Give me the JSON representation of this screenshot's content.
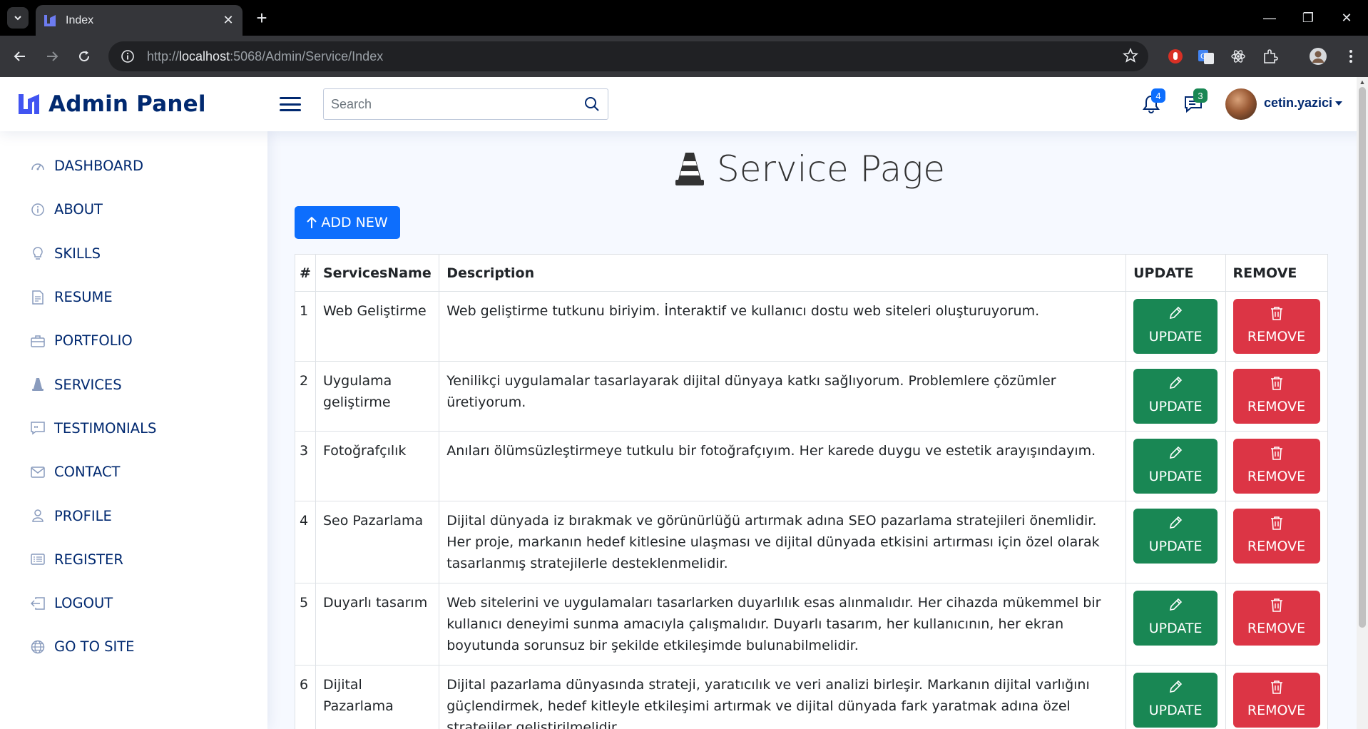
{
  "browser": {
    "tab_title": "Index",
    "url_scheme": "http://",
    "url_host": "localhost",
    "url_path": ":5068/Admin/Service/Index"
  },
  "header": {
    "brand": "Admin Panel",
    "search_placeholder": "Search",
    "notifications_count": "4",
    "messages_count": "3",
    "username": "cetin.yazici"
  },
  "sidebar": {
    "items": [
      {
        "label": "DASHBOARD",
        "icon": "speedometer-icon"
      },
      {
        "label": "ABOUT",
        "icon": "info-circle-icon"
      },
      {
        "label": "SKILLS",
        "icon": "lightbulb-icon"
      },
      {
        "label": "RESUME",
        "icon": "file-text-icon"
      },
      {
        "label": "PORTFOLIO",
        "icon": "briefcase-icon"
      },
      {
        "label": "SERVICES",
        "icon": "cone-icon"
      },
      {
        "label": "TESTIMONIALS",
        "icon": "chat-quote-icon"
      },
      {
        "label": "CONTACT",
        "icon": "envelope-icon"
      },
      {
        "label": "PROFILE",
        "icon": "person-icon"
      },
      {
        "label": "REGISTER",
        "icon": "card-list-icon"
      },
      {
        "label": "LOGOUT",
        "icon": "box-arrow-left-icon"
      },
      {
        "label": "GO TO SITE",
        "icon": "globe-icon"
      }
    ]
  },
  "main": {
    "title": "Service Page",
    "add_label": "ADD NEW",
    "columns": [
      "#",
      "ServicesName",
      "Description",
      "UPDATE",
      "REMOVE"
    ],
    "update_label": "UPDATE",
    "remove_label": "REMOVE",
    "rows": [
      {
        "id": "1",
        "name": "Web Geliştirme",
        "description": "Web geliştirme tutkunu biriyim. İnteraktif ve kullanıcı dostu web siteleri oluşturuyorum."
      },
      {
        "id": "2",
        "name": "Uygulama geliştirme",
        "description": "Yenilikçi uygulamalar tasarlayarak dijital dünyaya katkı sağlıyorum. Problemlere çözümler üretiyorum."
      },
      {
        "id": "3",
        "name": "Fotoğrafçılık",
        "description": "Anıları ölümsüzleştirmeye tutkulu bir fotoğrafçıyım. Her karede duygu ve estetik arayışındayım."
      },
      {
        "id": "4",
        "name": "Seo Pazarlama",
        "description": "Dijital dünyada iz bırakmak ve görünürlüğü artırmak adına SEO pazarlama stratejileri önemlidir. Her proje, markanın hedef kitlesine ulaşması ve dijital dünyada etkisini artırması için özel olarak tasarlanmış stratejilerle desteklenmelidir."
      },
      {
        "id": "5",
        "name": "Duyarlı tasarım",
        "description": "Web sitelerini ve uygulamaları tasarlarken duyarlılık esas alınmalıdır. Her cihazda mükemmel bir kullanıcı deneyimi sunma amacıyla çalışmalıdır. Duyarlı tasarım, her kullanıcının, her ekran boyutunda sorunsuz bir şekilde etkileşimde bulunabilmelidir."
      },
      {
        "id": "6",
        "name": "Dijital Pazarlama",
        "description": "Dijital pazarlama dünyasında strateji, yaratıcılık ve veri analizi birleşir. Markanın dijital varlığını güçlendirmek, hedef kitleyle etkileşimi artırmak ve dijital dünyada fark yaratmak adına özel stratejiler geliştirilmelidir."
      }
    ]
  },
  "colors": {
    "brand": "#012970",
    "primary": "#0d6efd",
    "success": "#198754",
    "danger": "#dc3545",
    "background": "#f6f9ff"
  }
}
